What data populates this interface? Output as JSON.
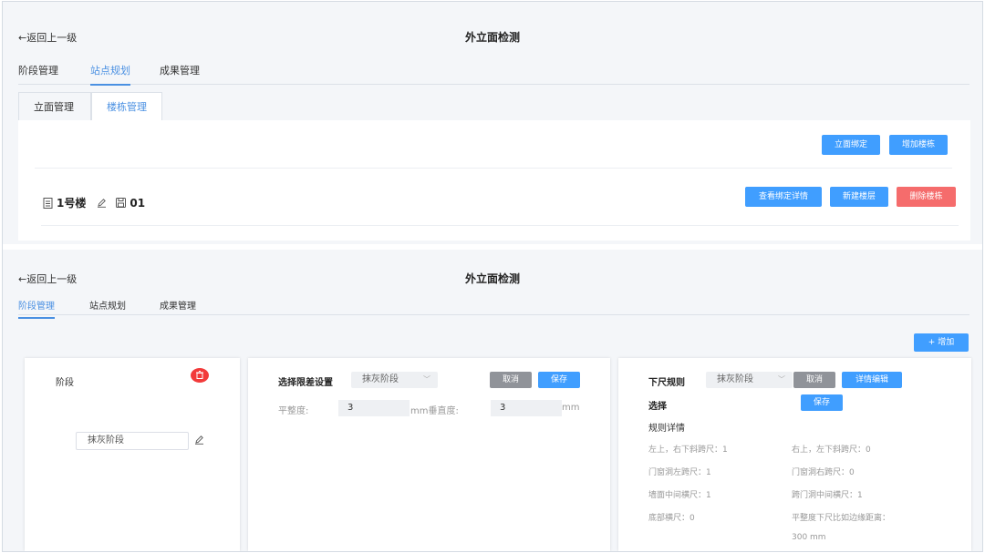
{
  "top": {
    "back_label": "←返回上一级",
    "title": "外立面检测",
    "tabs": [
      {
        "label": "阶段管理",
        "active": false
      },
      {
        "label": "站点规划",
        "active": true
      },
      {
        "label": "成果管理",
        "active": false
      }
    ],
    "subtabs": [
      {
        "label": "立面管理",
        "active": false
      },
      {
        "label": "楼栋管理",
        "active": true
      }
    ],
    "buttons": {
      "bind_facade": "立面绑定",
      "add_building": "增加楼栋"
    },
    "building": {
      "name": "1号楼",
      "code": "01",
      "btn_view": "查看绑定详情",
      "btn_new_floor": "新建楼层",
      "btn_delete": "删除楼栋"
    }
  },
  "bottom": {
    "back_label": "←返回上一级",
    "title": "外立面检测",
    "tabs": [
      {
        "label": "阶段管理",
        "active": true
      },
      {
        "label": "站点规划",
        "active": false
      },
      {
        "label": "成果管理",
        "active": false
      }
    ],
    "add_button": "+ 增加",
    "stage_card": {
      "title": "阶段",
      "input_value": "抹灰阶段"
    },
    "tolerance_card": {
      "label": "选择限差设置",
      "select_value": "抹灰阶段",
      "cancel": "取消",
      "save": "保存",
      "flatness_label": "平整度:",
      "flatness_value": "3",
      "verticality_label": "mm垂直度:",
      "verticality_value": "3",
      "unit": "mm"
    },
    "rule_card": {
      "label": "下尺规则",
      "select_value": "抹灰阶段",
      "cancel": "取消",
      "edit": "详情编辑",
      "choose_label": "选择",
      "save": "保存",
      "detail_title": "规则详情",
      "rules": [
        "左上，右下斜跨尺：1",
        "右上，左下斜跨尺：0",
        "门窗洞左跨尺：1",
        "门窗洞右跨尺：0",
        "墙面中间横尺：1",
        "跨门洞中间横尺：1",
        "底部横尺：0",
        "平整度下尺比如边缘距离："
      ],
      "distance_value": "300 mm"
    }
  },
  "colors": {
    "accent": "#409eff",
    "danger": "#f56c6c",
    "muted": "#909399",
    "delete_circle": "#f23a3a"
  }
}
